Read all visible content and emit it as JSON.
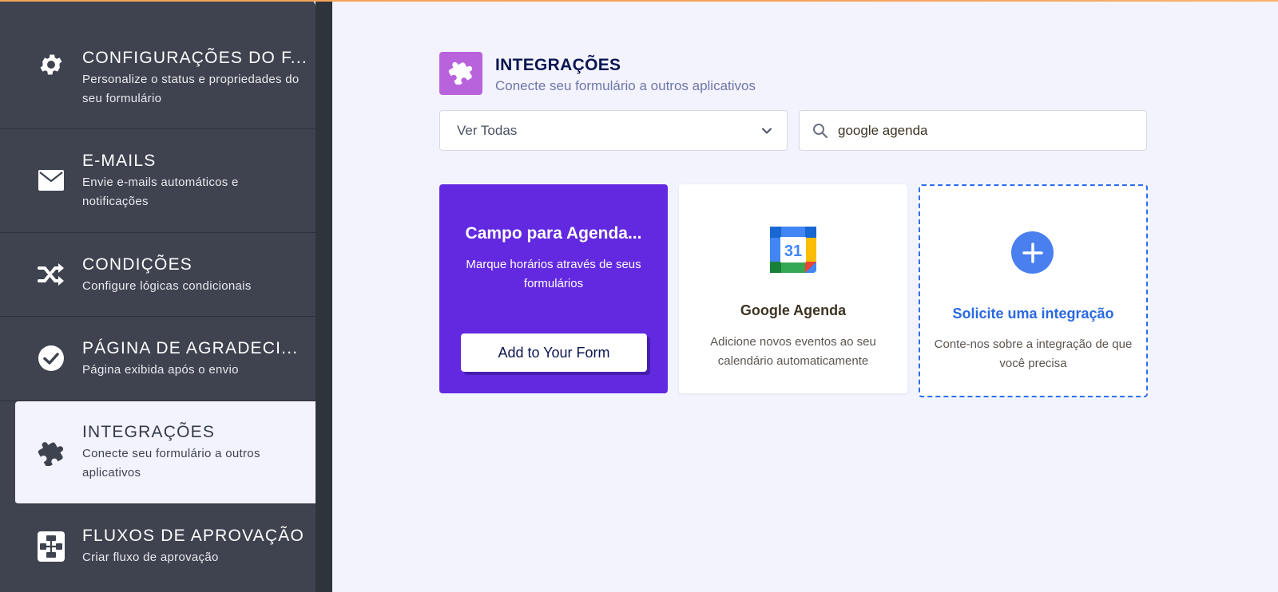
{
  "sidebar": {
    "items": [
      {
        "title": "CONFIGURAÇÕES DO F...",
        "desc": "Personalize o status e propriedades do seu formulário",
        "icon": "gear-icon"
      },
      {
        "title": "E-MAILS",
        "desc": "Envie e-mails automáticos e notificações",
        "icon": "envelope-icon"
      },
      {
        "title": "CONDIÇÕES",
        "desc": "Configure lógicas condicionais",
        "icon": "shuffle-icon"
      },
      {
        "title": "PÁGINA DE AGRADECI...",
        "desc": "Página exibida após o envio",
        "icon": "check-circle-icon"
      },
      {
        "title": "INTEGRAÇÕES",
        "desc": "Conecte seu formulário a outros aplicativos",
        "icon": "puzzle-icon",
        "active": true
      },
      {
        "title": "FLUXOS DE APROVAÇÃO",
        "desc": "Criar fluxo de aprovação",
        "icon": "flowchart-icon"
      }
    ]
  },
  "header": {
    "title": "INTEGRAÇÕES",
    "subtitle": "Conecte seu formulário a outros aplicativos",
    "icon": "puzzle-icon",
    "icon_color": "#b863dc"
  },
  "filters": {
    "category_selected": "Ver Todas",
    "search_value": "google agenda"
  },
  "cards": {
    "promo": {
      "title": "Campo para Agenda...",
      "desc": "Marque horários através de seus formulários",
      "button": "Add to Your Form",
      "color": "#6229e0"
    },
    "app": {
      "logo_number": "31",
      "title": "Google Agenda",
      "desc": "Adicione novos eventos ao seu calendário automaticamente"
    },
    "request": {
      "title": "Solicite uma integração",
      "desc": "Conte-nos sobre a integração de que você precisa",
      "color": "#2e6ff2"
    }
  }
}
